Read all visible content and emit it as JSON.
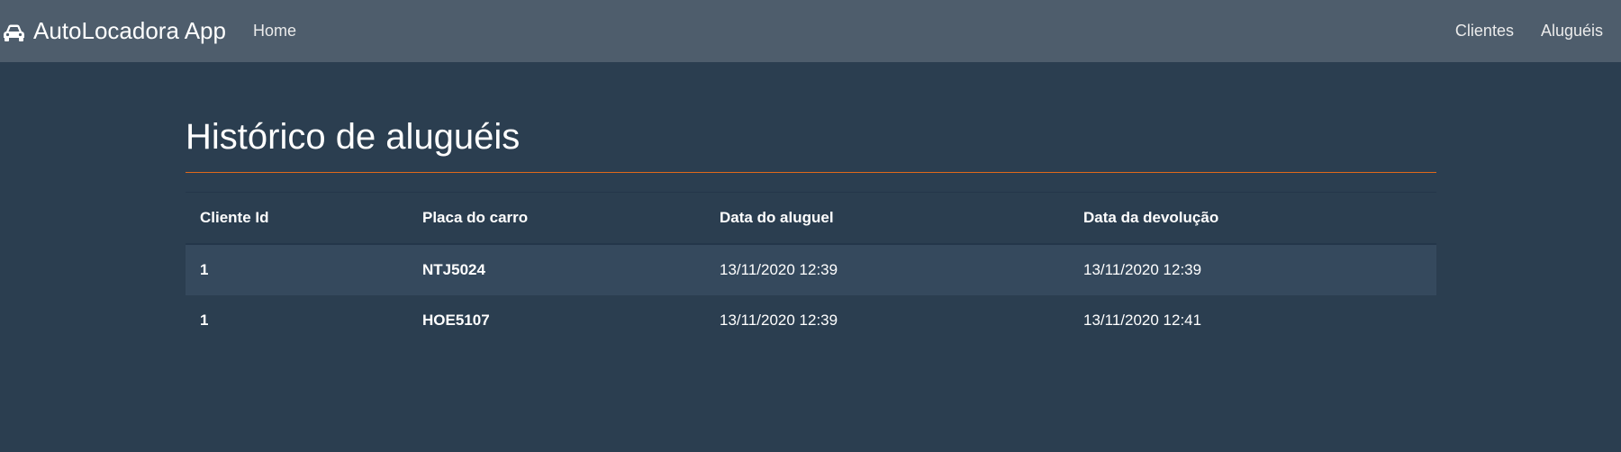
{
  "navbar": {
    "brand": "AutoLocadora App",
    "brand_icon": "car-icon",
    "home_label": "Home",
    "clientes_label": "Clientes",
    "alugueis_label": "Aluguéis"
  },
  "page": {
    "title": "Histórico de aluguéis",
    "accent_color": "#df691a"
  },
  "table": {
    "headers": [
      "Cliente Id",
      "Placa do carro",
      "Data do aluguel",
      "Data da devolução"
    ],
    "rows": [
      [
        "1",
        "NTJ5024",
        "13/11/2020 12:39",
        "13/11/2020 12:39"
      ],
      [
        "1",
        "HOE5107",
        "13/11/2020 12:39",
        "13/11/2020 12:41"
      ]
    ]
  }
}
